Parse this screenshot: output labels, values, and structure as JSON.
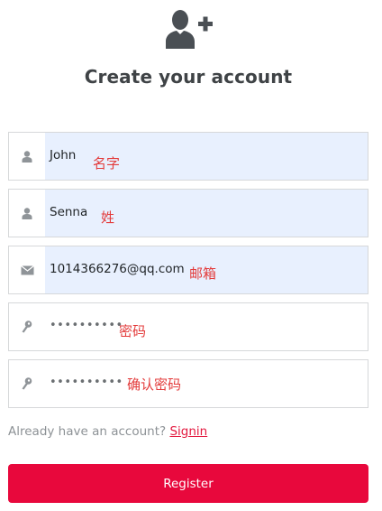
{
  "title": "Create your account",
  "icons": {
    "header": "add-user-icon",
    "name_field": "user-icon",
    "email_field": "envelope-icon",
    "password_field": "key-icon"
  },
  "fields": {
    "first_name": {
      "value": "John",
      "note": "名字"
    },
    "last_name": {
      "value": "Senna",
      "note": "姓"
    },
    "email": {
      "value": "1014366276@qq.com",
      "note": "邮箱"
    },
    "password": {
      "value": "••••••••••",
      "note": "密码"
    },
    "confirm_password": {
      "value": "••••••••••",
      "note": "确认密码"
    }
  },
  "signin": {
    "prompt": "Already have an account?",
    "link": "Signin"
  },
  "register": {
    "label": "Register"
  },
  "colors": {
    "accent": "#e8083c",
    "autofill": "#e8f0fe",
    "note": "#e33b3b",
    "title": "#3f4346"
  }
}
